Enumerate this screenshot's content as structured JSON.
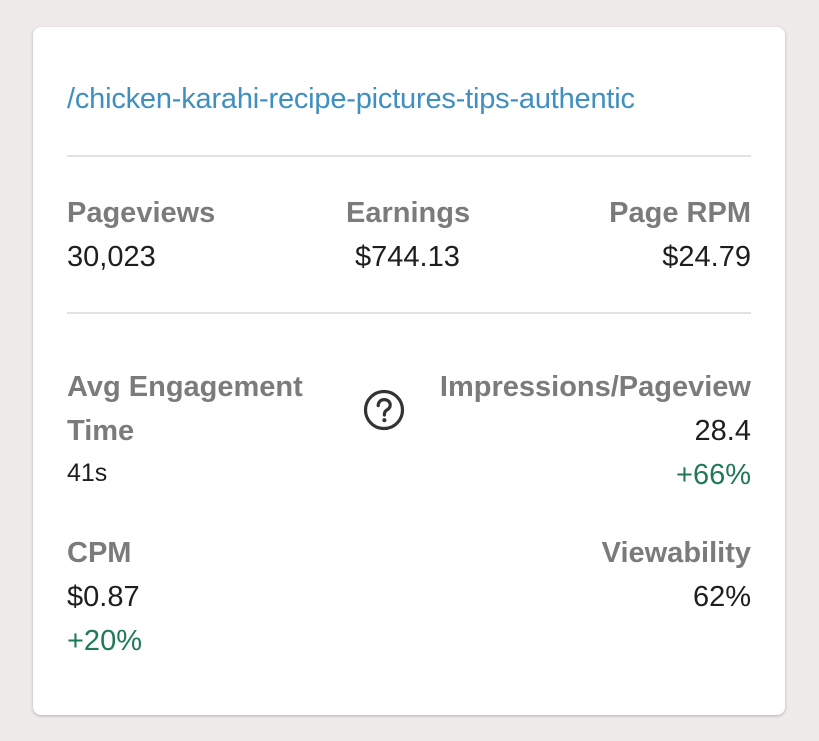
{
  "page": {
    "path": "/chicken-karahi-recipe-pictures-tips-authentic"
  },
  "summary": {
    "pageviews": {
      "label": "Pageviews",
      "value": "30,023"
    },
    "earnings": {
      "label": "Earnings",
      "value": "$744.13"
    },
    "page_rpm": {
      "label": "Page RPM",
      "value": "$24.79"
    }
  },
  "details": {
    "avg_engagement": {
      "label_line1": "Avg Engagement",
      "label_line2": "Time",
      "value": "41s"
    },
    "impressions_per_pageview": {
      "label": "Impressions/Pageview",
      "value": "28.4",
      "delta": "+66%"
    },
    "cpm": {
      "label": "CPM",
      "value": "$0.87",
      "delta": "+20%"
    },
    "viewability": {
      "label": "Viewability",
      "value": "62%"
    }
  },
  "icons": {
    "help": "question-circle-icon"
  },
  "colors": {
    "link": "#3f8fc1",
    "label": "#7b7b7b",
    "positive_delta": "#1f7a55",
    "background": "#f0ebeb"
  }
}
